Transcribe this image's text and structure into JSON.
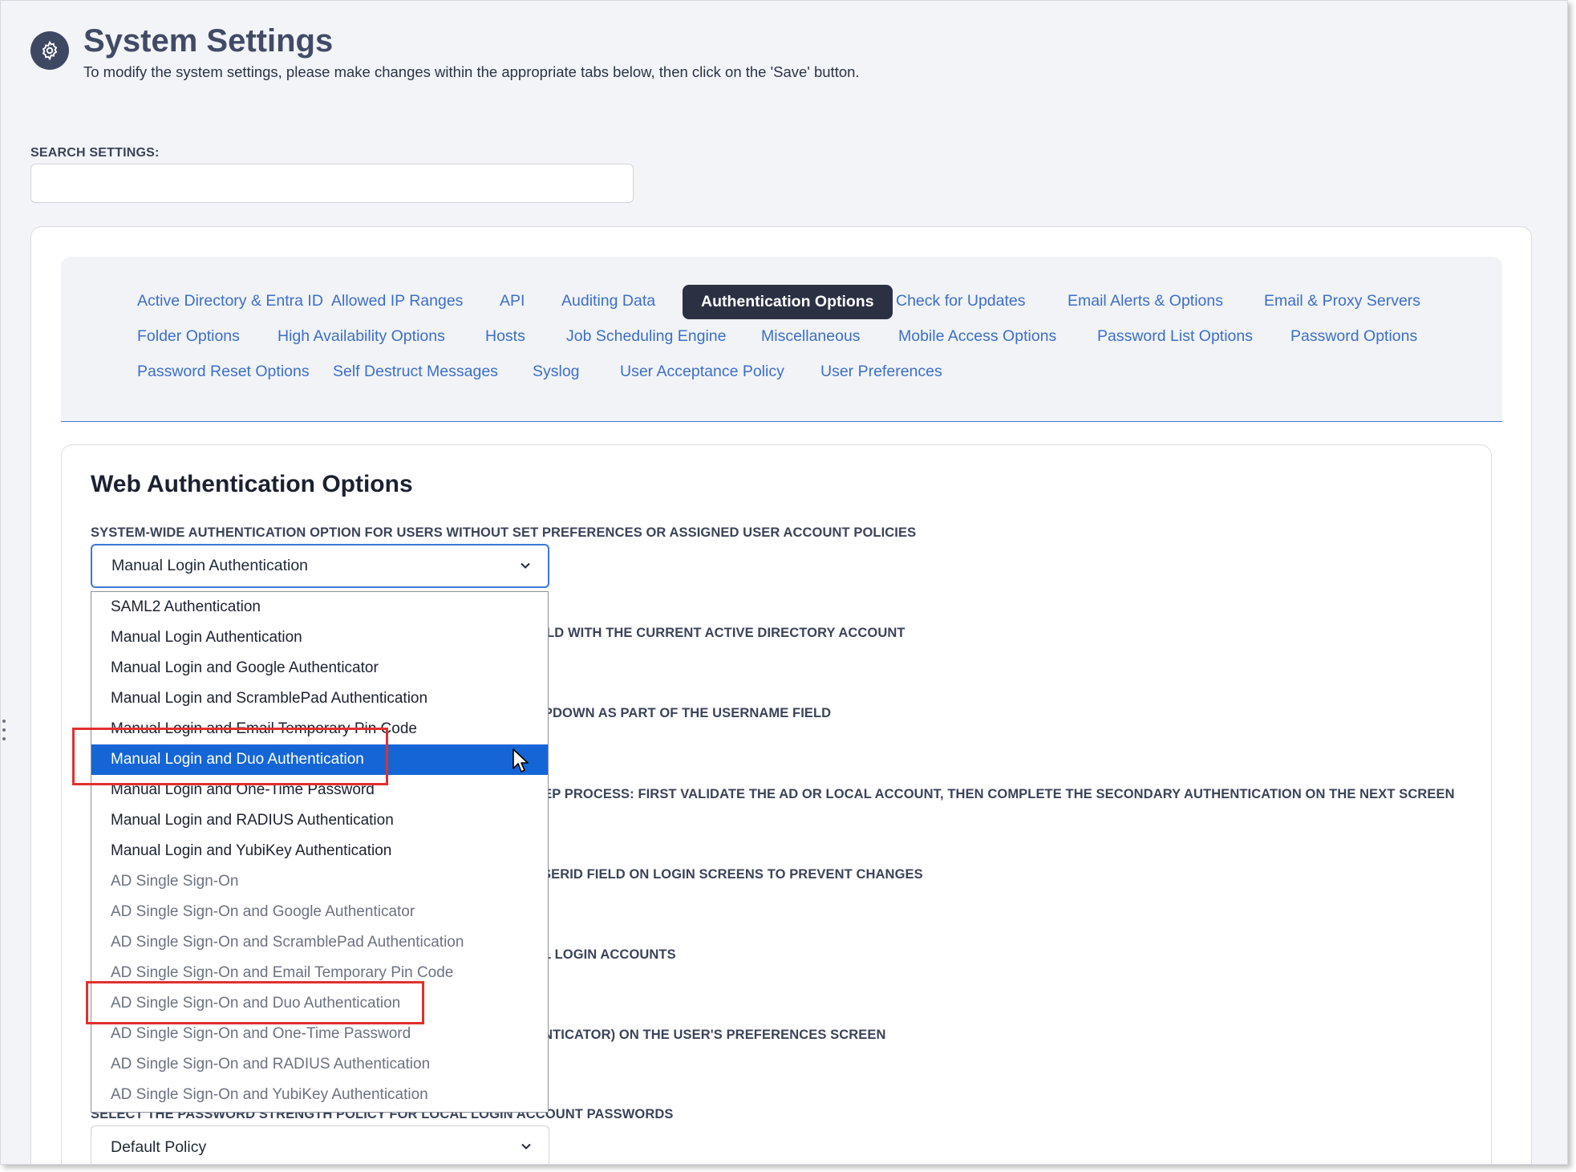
{
  "header": {
    "title": "System Settings",
    "subtitle": "To modify the system settings, please make changes within the appropriate tabs below, then click on the 'Save' button."
  },
  "search": {
    "label": "SEARCH SETTINGS:",
    "value": ""
  },
  "tabs": [
    {
      "label": "Active Directory & Entra ID"
    },
    {
      "label": "Allowed IP Ranges"
    },
    {
      "label": "API"
    },
    {
      "label": "Auditing Data"
    },
    {
      "label": "Authentication Options",
      "active": true
    },
    {
      "label": "Check for Updates"
    },
    {
      "label": "Email Alerts & Options"
    },
    {
      "label": "Email & Proxy Servers"
    },
    {
      "label": "Folder Options"
    },
    {
      "label": "High Availability Options"
    },
    {
      "label": "Hosts"
    },
    {
      "label": "Job Scheduling Engine"
    },
    {
      "label": "Miscellaneous"
    },
    {
      "label": "Mobile Access Options"
    },
    {
      "label": "Password List Options"
    },
    {
      "label": "Password Options"
    },
    {
      "label": "Password Reset Options"
    },
    {
      "label": "Self Destruct Messages"
    },
    {
      "label": "Syslog"
    },
    {
      "label": "User Acceptance Policy"
    },
    {
      "label": "User Preferences"
    }
  ],
  "section": {
    "title": "Web Authentication Options",
    "system_option_label": "SYSTEM-WIDE AUTHENTICATION OPTION FOR USERS WITHOUT SET PREFERENCES OR ASSIGNED USER ACCOUNT POLICIES",
    "system_option_value": "Manual Login Authentication",
    "partial_labels": [
      "ELD WITH THE CURRENT ACTIVE DIRECTORY ACCOUNT",
      "OPDOWN AS PART OF THE USERNAME FIELD",
      "TEP PROCESS: FIRST VALIDATE THE AD OR LOCAL ACCOUNT, THEN COMPLETE THE SECONDARY AUTHENTICATION ON THE NEXT SCREEN",
      "USERID FIELD ON LOGIN SCREENS TO PREVENT CHANGES",
      "AL LOGIN ACCOUNTS",
      "ENTICATOR) ON THE USER'S PREFERENCES SCREEN"
    ],
    "password_policy_label": "SELECT THE PASSWORD STRENGTH POLICY FOR LOCAL LOGIN ACCOUNT PASSWORDS",
    "password_policy_value": "Default Policy"
  },
  "dropdown_options": [
    {
      "label": "SAML2 Authentication"
    },
    {
      "label": "Manual Login Authentication"
    },
    {
      "label": "Manual Login and Google Authenticator"
    },
    {
      "label": "Manual Login and ScramblePad Authentication"
    },
    {
      "label": "Manual Login and Email Temporary Pin Code"
    },
    {
      "label": "Manual Login and Duo Authentication",
      "highlighted": true
    },
    {
      "label": "Manual Login and One-Time Password"
    },
    {
      "label": "Manual Login and RADIUS Authentication"
    },
    {
      "label": "Manual Login and YubiKey Authentication"
    },
    {
      "label": "AD Single Sign-On"
    },
    {
      "label": "AD Single Sign-On and Google Authenticator"
    },
    {
      "label": "AD Single Sign-On and ScramblePad Authentication"
    },
    {
      "label": "AD Single Sign-On and Email Temporary Pin Code"
    },
    {
      "label": "AD Single Sign-On and Duo Authentication"
    },
    {
      "label": "AD Single Sign-On and One-Time Password"
    },
    {
      "label": "AD Single Sign-On and RADIUS Authentication"
    },
    {
      "label": "AD Single Sign-On and YubiKey Authentication"
    }
  ],
  "colors": {
    "accent": "#3b78d8",
    "highlight": "#1466d6",
    "active_tab": "#2b3042",
    "annotation": "#e0302f"
  }
}
